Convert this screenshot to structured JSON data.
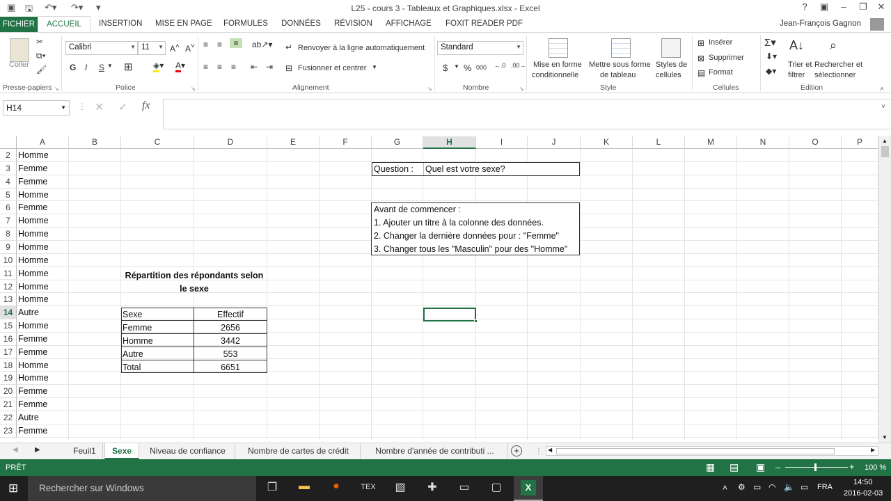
{
  "window": {
    "title": "L25 - cours 3 - Tableaux et Graphiques.xlsx - Excel",
    "user": "Jean-François Gagnon"
  },
  "tabs": [
    "FICHIER",
    "ACCUEIL",
    "INSERTION",
    "MISE EN PAGE",
    "FORMULES",
    "DONNÉES",
    "RÉVISION",
    "AFFICHAGE",
    "FOXIT READER PDF"
  ],
  "ribbon": {
    "clipboard": {
      "paste": "Coller",
      "group": "Presse-papiers"
    },
    "font": {
      "name": "Calibri",
      "size": "11",
      "bold": "G",
      "italic": "I",
      "underline": "S",
      "group": "Police"
    },
    "alignment": {
      "wrap": "Renvoyer à la ligne automatiquement",
      "merge": "Fusionner et centrer",
      "group": "Alignement"
    },
    "number": {
      "format": "Standard",
      "currency": "$",
      "percent": "%",
      "thousands": "000",
      "group": "Nombre"
    },
    "styles": {
      "cond1": "Mise en forme",
      "cond2": "conditionnelle",
      "table1": "Mettre sous forme",
      "table2": "de tableau",
      "cell1": "Styles de",
      "cell2": "cellules",
      "group": "Style"
    },
    "cells": {
      "insert": "Insérer",
      "delete": "Supprimer",
      "format": "Format",
      "group": "Cellules"
    },
    "editing": {
      "sort1": "Trier et",
      "sort2": "filtrer",
      "find1": "Rechercher et",
      "find2": "sélectionner",
      "group": "Édition"
    }
  },
  "formula_bar": {
    "name_box": "H14",
    "fx": "fx",
    "content": ""
  },
  "columns": [
    "A",
    "B",
    "C",
    "D",
    "E",
    "F",
    "G",
    "H",
    "I",
    "J",
    "K",
    "L",
    "M",
    "N",
    "O",
    "P"
  ],
  "rows": [
    "2",
    "3",
    "4",
    "5",
    "6",
    "7",
    "8",
    "9",
    "10",
    "11",
    "12",
    "13",
    "14",
    "15",
    "16",
    "17",
    "18",
    "19",
    "20",
    "21",
    "22",
    "23"
  ],
  "column_a": [
    "Homme",
    "Femme",
    "Femme",
    "Homme",
    "Femme",
    "Homme",
    "Homme",
    "Homme",
    "Homme",
    "Homme",
    "Homme",
    "Homme",
    "Autre",
    "Homme",
    "Femme",
    "Femme",
    "Homme",
    "Homme",
    "Femme",
    "Femme",
    "Autre",
    "Femme"
  ],
  "question": {
    "label": "Question :",
    "text": "Quel est votre sexe?"
  },
  "instructions": [
    "Avant de commencer :",
    "1. Ajouter un titre à la colonne des données.",
    "2. Changer la dernière données pour : \"Femme\"",
    "3. Changer tous les \"Masculin\" pour des \"Homme\""
  ],
  "summary": {
    "title1": "Répartition des répondants selon",
    "title2": "le sexe",
    "headers": [
      "Sexe",
      "Effectif"
    ],
    "rows": [
      [
        "Femme",
        "2656"
      ],
      [
        "Homme",
        "3442"
      ],
      [
        "Autre",
        "553"
      ],
      [
        "Total",
        "6651"
      ]
    ]
  },
  "sheets": [
    "Feuil1",
    "Sexe",
    "Niveau de confiance",
    "Nombre de cartes de crédit",
    "Nombre d'année de contributi ..."
  ],
  "status": {
    "mode": "PRÊT",
    "zoom": "100 %"
  },
  "taskbar": {
    "search": "Rechercher sur Windows",
    "lang": "FRA",
    "time": "14:50",
    "date": "2016-02-03"
  }
}
